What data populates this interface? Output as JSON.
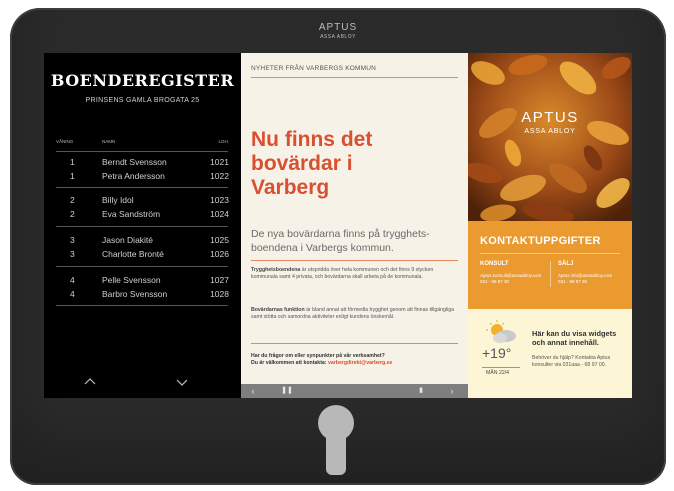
{
  "device": {
    "brand": "APTUS",
    "brand_sub": "ASSA ABLOY"
  },
  "register": {
    "title": "BOENDEREGISTER",
    "address": "PRINSENS GAMLA BROGATA 25",
    "col_floor": "VÅNING",
    "col_name": "NAMN",
    "col_apt": "LGH.",
    "residents": [
      {
        "floor": "1",
        "name": "Berndt Svensson",
        "apt": "1021"
      },
      {
        "floor": "1",
        "name": "Petra Andersson",
        "apt": "1022"
      },
      {
        "floor": "2",
        "name": "Billy Idol",
        "apt": "1023"
      },
      {
        "floor": "2",
        "name": "Eva Sandström",
        "apt": "1024"
      },
      {
        "floor": "3",
        "name": "Jason Diakité",
        "apt": "1025"
      },
      {
        "floor": "3",
        "name": "Charlotte Bronté",
        "apt": "1026"
      },
      {
        "floor": "4",
        "name": "Pelle Svensson",
        "apt": "1027"
      },
      {
        "floor": "4",
        "name": "Barbro Svensson",
        "apt": "1028"
      }
    ]
  },
  "news": {
    "header": "NYHETER FRÅN VARBERGS KOMMUN",
    "headline_1": "Nu finns det",
    "headline_2": "bovärdar i",
    "headline_3": "Varberg",
    "lead": "De nya bovärdarna finns på trygghets-boendena i Varbergs kommun.",
    "para1_bold": "Trygghetsboendena",
    "para1_text": " är utspridda över hela kommunen och det finns 9 stycken kommunala samt 4 privata, och bovärdarna skall arbeta på de kommunala.",
    "para2_bold": "Bovärdarnas funktion",
    "para2_text": " är bland annat att förmedla trygghet genom att finnas tillgängliga samt stötta och samordna aktiviteter enligt kundens önskemål.",
    "contact_line1": "Har du frågor om eller synpunkter på vår verksamhet?",
    "contact_line2": "Du är välkommen att kontakta: ",
    "contact_email": "varbergdirekt@varberg.se"
  },
  "right": {
    "brand": "APTUS",
    "brand_sub": "ASSA ABLOY",
    "contacts_title": "KONTAKTUPPGIFTER",
    "consult_label": "KONSULT",
    "consult_email": "Aptus.konsult@assaabloy.com",
    "consult_phone": "031 - 68 97 30",
    "sales_label": "SÄLJ",
    "sales_email": "Aptus.info@assaabloy.com",
    "sales_phone": "031 - 68 97 30",
    "weather_temp": "+19°",
    "weather_date": "MÅN 22/4",
    "widget_title": "Här kan du visa widgets och annat innehåll.",
    "widget_body": "Behöver du hjälp? Kontakta Aptus konsulter via 031aaa - 68 97 00."
  },
  "colors": {
    "accent_red": "#d8502f",
    "accent_orange": "#eb9a2f",
    "news_bg": "#f7f2e8",
    "register_bg": "#000000"
  }
}
